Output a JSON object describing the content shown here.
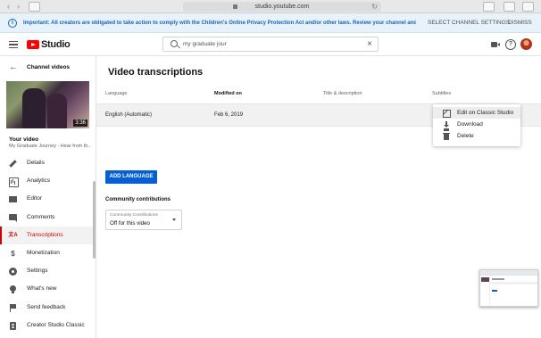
{
  "browser": {
    "back": "‹",
    "forward": "›",
    "url": "studio.youtube.com",
    "reload": "↻"
  },
  "banner": {
    "message": "Important: All creators are obligated to take action to comply with the Children's Online Privacy Protection Act and/or other laws. Review your channel and video settings.",
    "select_settings_label": "SELECT CHANNEL SETTINGS",
    "dismiss_label": "DISMISS",
    "info_glyph": "i"
  },
  "header": {
    "logo_text": "Studio",
    "search_value": "my graduate jour",
    "clear_glyph": "×",
    "help_glyph": "?"
  },
  "sidebar": {
    "back_label": "Channel videos",
    "back_glyph": "←",
    "thumbnail_duration": "3:36",
    "your_video_label": "Your video",
    "video_title": "My Graduate Journey - Hear from th...",
    "items": [
      {
        "label": "Details",
        "icon": "pencil-icon",
        "active": false
      },
      {
        "label": "Analytics",
        "icon": "analytics-icon",
        "active": false
      },
      {
        "label": "Editor",
        "icon": "film-icon",
        "active": false
      },
      {
        "label": "Comments",
        "icon": "comment-icon",
        "active": false
      },
      {
        "label": "Transcriptions",
        "icon": "translate-icon",
        "active": true,
        "glyph": "文A"
      },
      {
        "label": "Monetization",
        "icon": "dollar-icon",
        "active": false,
        "glyph": "$"
      },
      {
        "label": "Settings",
        "icon": "gear-icon",
        "active": false
      },
      {
        "label": "What's new",
        "icon": "lightbulb-icon",
        "active": false
      },
      {
        "label": "Send feedback",
        "icon": "flag-icon",
        "active": false
      },
      {
        "label": "Creator Studio Classic",
        "icon": "classic-icon",
        "active": false
      }
    ]
  },
  "main": {
    "title": "Video transcriptions",
    "columns": {
      "language": "Language",
      "modified": "Modified on",
      "title_desc": "Title & description",
      "subtitles": "Subtitles"
    },
    "rows": [
      {
        "language": "English (Automatic)",
        "modified": "Feb 6, 2019"
      }
    ],
    "menu": [
      {
        "label": "Edit on Classic Studio",
        "icon": "edit-external-icon"
      },
      {
        "label": "Download",
        "icon": "download-icon"
      },
      {
        "label": "Delete",
        "icon": "trash-icon"
      }
    ],
    "add_language_label": "ADD LANGUAGE",
    "community_heading": "Community contributions",
    "community_select": {
      "label": "Community Contributions",
      "value": "Off for this video"
    }
  },
  "colors": {
    "accent": "#065fd4",
    "brand": "#ff0000",
    "active_nav": "#cc0000",
    "banner_text": "#1c62b9"
  }
}
